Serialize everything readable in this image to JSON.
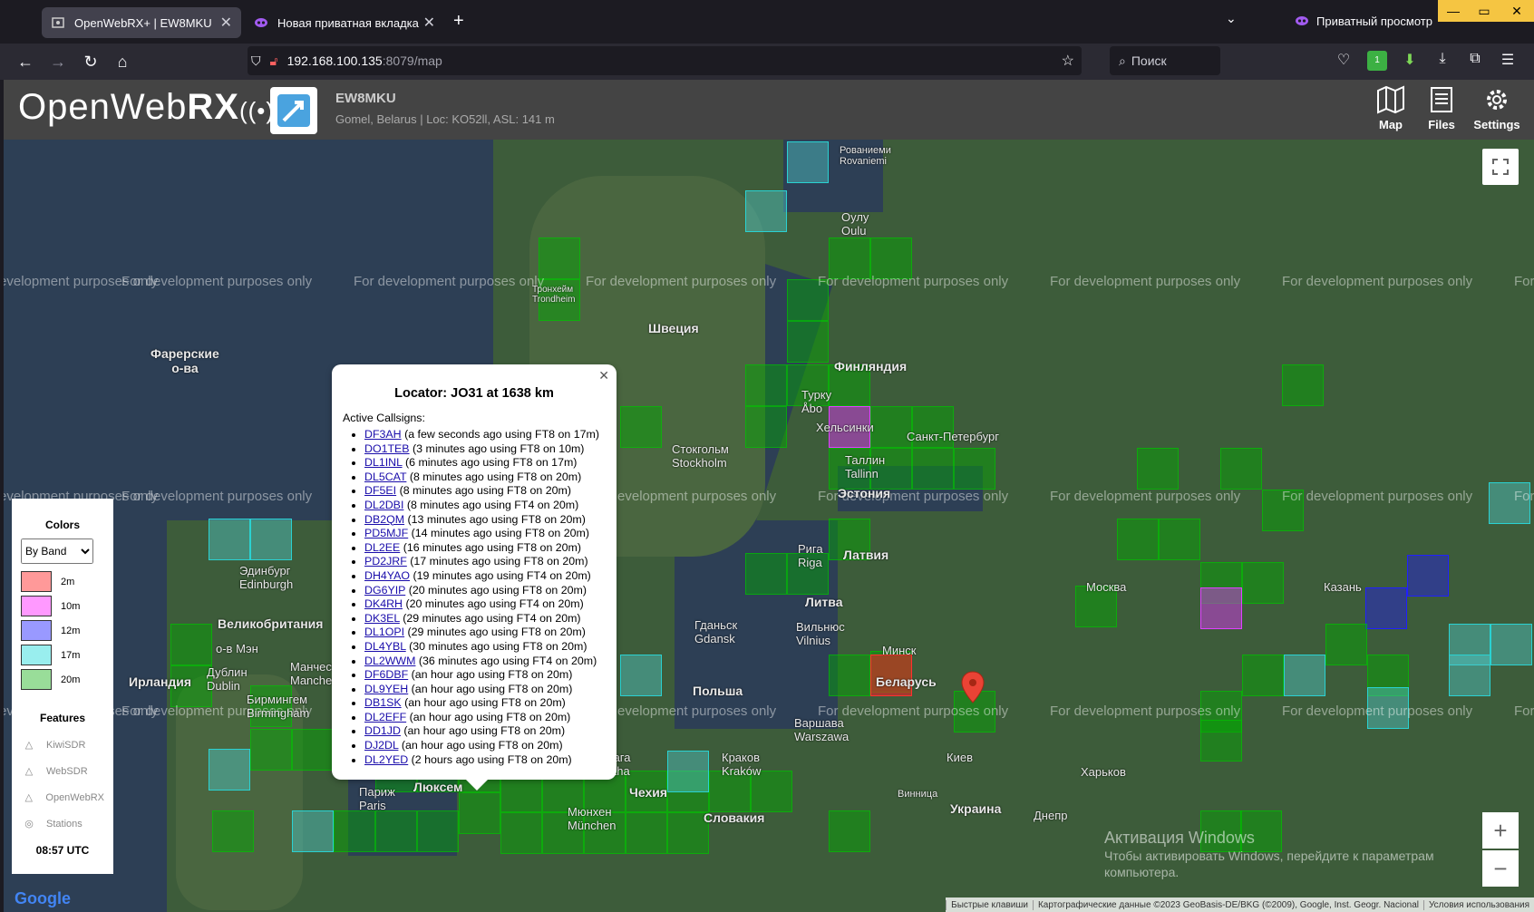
{
  "browser": {
    "tabs": [
      {
        "title": "OpenWebRX+ | EW8MKU",
        "active": true
      },
      {
        "title": "Новая приватная вкладка",
        "active": false
      }
    ],
    "private_label": "Приватный просмотр",
    "url_host": "192.168.100.135",
    "url_rest": ":8079/map",
    "search_placeholder": "Поиск",
    "extension_badge": "1"
  },
  "header": {
    "logo_light": "OpenWeb",
    "logo_bold": "RX",
    "receiver_name": "EW8MKU",
    "receiver_desc": "Gomel, Belarus | Loc: KO52ll, ASL: 141 m",
    "buttons": [
      {
        "label": "Map",
        "icon": "map-icon"
      },
      {
        "label": "Files",
        "icon": "files-icon"
      },
      {
        "label": "Settings",
        "icon": "settings-icon"
      }
    ]
  },
  "map": {
    "watermark": "For development purposes only",
    "places": {
      "rovaniemi": "Рованиеми\nRovaniemi",
      "oulu": "Оулу\nOulu",
      "sweden": "Швеция",
      "finland": "Финляндия",
      "faroe": "Фарерские\nо-ва",
      "turku": "Турку\nÅbo",
      "helsinki": "Хельсинки",
      "spb": "Санкт-Петербург",
      "tallinn": "Таллин\nTallinn",
      "estonia": "Эстония",
      "stockholm": "Стокгольм\nStockholm",
      "riga": "Рига\nRiga",
      "latvia": "Латвия",
      "moscow": "Москва",
      "kazan": "Казань",
      "lithuania": "Литва",
      "vilnius": "Вильнюс\nVilnius",
      "minsk": "Минск",
      "belarus": "Беларусь",
      "gdansk": "Гданьск\nGdansk",
      "poland": "Польша",
      "warsaw": "Варшава\nWarszawa",
      "edinburgh": "Эдинбург\nEdinburgh",
      "gb": "Великобритания",
      "ireland": "Ирландия",
      "dublin": "Дублин\nDublin",
      "birmingham": "Бирмингем\nBirmingham",
      "manchester": "Манчестер\nManchester",
      "kiev": "Киев",
      "kharkiv": "Харьков",
      "vinnytsia": "Винница",
      "ukraine": "Украина",
      "dnipro": "Днепр",
      "krakow": "Краков\nKraków",
      "czech": "Чехия",
      "slovakia": "Словакия",
      "luxembourg": "Люксем",
      "paris": "Париж\nParis",
      "munich": "Мюнхен\nMünchen",
      "praha": "Прага\nPraha",
      "isle_of_man": "о-в Мэн",
      "trondheim": "Тронхейм\nTrondheim"
    },
    "attribution": [
      "Быстрые клавиши",
      "Картографические данные ©2023 GeoBasis-DE/BKG (©2009), Google, Inst. Geogr. Nacional",
      "Условия использования"
    ],
    "google_logo": "Google",
    "activation_title": "Активация Windows",
    "activation_text": "Чтобы активировать Windows, перейдите к параметрам компьютера."
  },
  "legend": {
    "colors_title": "Colors",
    "select_value": "By Band",
    "bands": [
      {
        "label": "2m",
        "color": "#ff9999"
      },
      {
        "label": "10m",
        "color": "#ff99ff"
      },
      {
        "label": "12m",
        "color": "#9999ff"
      },
      {
        "label": "17m",
        "color": "#99eeee"
      },
      {
        "label": "20m",
        "color": "#99dd99"
      }
    ],
    "features_title": "Features",
    "features": [
      "KiwiSDR",
      "WebSDR",
      "OpenWebRX",
      "Stations"
    ],
    "clock": "08:57 UTC"
  },
  "popup": {
    "title": "Locator: JO31 at 1638 km",
    "subtitle": "Active Callsigns:",
    "callsigns": [
      {
        "call": "DF3AH",
        "info": "(a few seconds ago using FT8 on 17m)"
      },
      {
        "call": "DO1TEB",
        "info": "(3 minutes ago using FT8 on 10m)"
      },
      {
        "call": "DL1INL",
        "info": "(6 minutes ago using FT8 on 17m)"
      },
      {
        "call": "DL5CAT",
        "info": "(8 minutes ago using FT8 on 20m)"
      },
      {
        "call": "DF5EI",
        "info": "(8 minutes ago using FT8 on 20m)"
      },
      {
        "call": "DL2DBI",
        "info": "(8 minutes ago using FT4 on 20m)"
      },
      {
        "call": "DB2QM",
        "info": "(13 minutes ago using FT8 on 20m)"
      },
      {
        "call": "PD5MJF",
        "info": "(14 minutes ago using FT8 on 20m)"
      },
      {
        "call": "DL2EE",
        "info": "(16 minutes ago using FT8 on 20m)"
      },
      {
        "call": "PD2JRF",
        "info": "(17 minutes ago using FT8 on 20m)"
      },
      {
        "call": "DH4YAO",
        "info": "(19 minutes ago using FT4 on 20m)"
      },
      {
        "call": "DG6YIP",
        "info": "(20 minutes ago using FT8 on 20m)"
      },
      {
        "call": "DK4RH",
        "info": "(20 minutes ago using FT4 on 20m)"
      },
      {
        "call": "DK3EL",
        "info": "(29 minutes ago using FT4 on 20m)"
      },
      {
        "call": "DL1OPI",
        "info": "(29 minutes ago using FT8 on 20m)"
      },
      {
        "call": "DL4YBL",
        "info": "(30 minutes ago using FT8 on 20m)"
      },
      {
        "call": "DL2WWM",
        "info": "(36 minutes ago using FT4 on 20m)"
      },
      {
        "call": "DF6DBF",
        "info": "(an hour ago using FT8 on 20m)"
      },
      {
        "call": "DL9YEH",
        "info": "(an hour ago using FT8 on 20m)"
      },
      {
        "call": "DB1SK",
        "info": "(an hour ago using FT8 on 20m)"
      },
      {
        "call": "DL2EFF",
        "info": "(an hour ago using FT8 on 20m)"
      },
      {
        "call": "DD1JD",
        "info": "(an hour ago using FT8 on 20m)"
      },
      {
        "call": "DJ2DL",
        "info": "(an hour ago using FT8 on 20m)"
      },
      {
        "call": "DL2YED",
        "info": "(2 hours ago using FT8 on 20m)"
      }
    ]
  }
}
